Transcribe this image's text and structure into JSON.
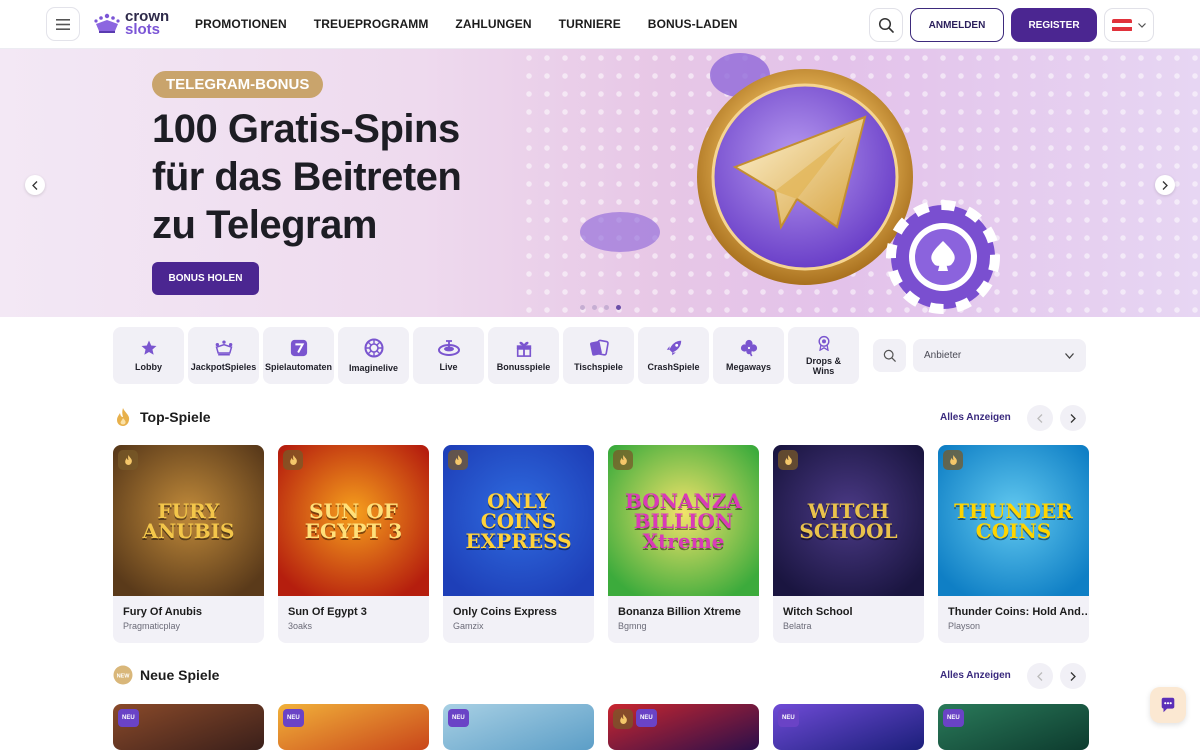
{
  "header": {
    "logo": {
      "line1": "crown",
      "line2": "slots"
    },
    "nav": [
      "PROMOTIONEN",
      "TREUEPROGRAMM",
      "ZAHLUNGEN",
      "TURNIERE",
      "BONUS-LADEN"
    ],
    "login_label": "ANMELDEN",
    "register_label": "REGISTER",
    "language_flag": "austria-flag-icon"
  },
  "hero": {
    "badge": "TELEGRAM-BONUS",
    "title_lines": [
      "100 Gratis-Spins",
      "für das Beitreten",
      "zu Telegram"
    ],
    "cta": "BONUS HOLEN",
    "slides": 4,
    "active_slide": 4
  },
  "categories": [
    {
      "label": "Lobby",
      "icon": "star-icon"
    },
    {
      "label": "JackpotSpieles",
      "icon": "crown-icon"
    },
    {
      "label": "Spielautomaten",
      "icon": "slot-seven-icon"
    },
    {
      "label": "Imaginelive",
      "icon": "chip-icon"
    },
    {
      "label": "Live",
      "icon": "roulette-icon"
    },
    {
      "label": "Bonusspiele",
      "icon": "gift-icon"
    },
    {
      "label": "Tischspiele",
      "icon": "cards-icon"
    },
    {
      "label": "CrashSpiele",
      "icon": "rocket-icon"
    },
    {
      "label": "Megaways",
      "icon": "clover-icon"
    },
    {
      "label": "Drops & Wins",
      "icon": "prize-icon"
    }
  ],
  "provider_select": {
    "placeholder": "Anbieter"
  },
  "top_games": {
    "title": "Top-Spiele",
    "view_all": "Alles Anzeigen",
    "items": [
      {
        "name": "Fury Of Anubis",
        "provider": "Pragmaticplay",
        "art": "FURY ANUBIS",
        "bg1": "#5a3a1a",
        "bg2": "#c08a3a",
        "fg": "#f3c64a"
      },
      {
        "name": "Sun Of Egypt 3",
        "provider": "3oaks",
        "art": "SUN OF EGYPT 3",
        "bg1": "#b51e0e",
        "bg2": "#f6a01d",
        "fg": "#ffe07a"
      },
      {
        "name": "Only Coins Express",
        "provider": "Gamzix",
        "art": "ONLY COINS EXPRESS",
        "bg1": "#1e3fb8",
        "bg2": "#2f6ce0",
        "fg": "#ffd23a"
      },
      {
        "name": "Bonanza Billion Xtreme",
        "provider": "Bgmng",
        "art": "BONANZA BILLION Xtreme",
        "bg1": "#3cab3c",
        "bg2": "#f2e36a",
        "fg": "#d93ab8"
      },
      {
        "name": "Witch School",
        "provider": "Belatra",
        "art": "WITCH SCHOOL",
        "bg1": "#1a1540",
        "bg2": "#4b3a86",
        "fg": "#e9c24c"
      },
      {
        "name": "Thunder Coins: Hold And…",
        "provider": "Playson",
        "art": "THUNDER COINS",
        "bg1": "#0f7fc5",
        "bg2": "#62c9f0",
        "fg": "#ffd400"
      }
    ]
  },
  "new_games": {
    "title": "Neue Spiele",
    "view_all": "Alles Anzeigen",
    "badge": "NEU",
    "items": [
      {
        "bg1": "#3a1f1a",
        "bg2": "#8a4a2a"
      },
      {
        "bg1": "#c9461a",
        "bg2": "#f1b13a"
      },
      {
        "bg1": "#5c9ec7",
        "bg2": "#a8d0e4"
      },
      {
        "bg1": "#2b0f4a",
        "bg2": "#c9262f"
      },
      {
        "bg1": "#1b1f7a",
        "bg2": "#6f4bd6"
      },
      {
        "bg1": "#0d3b2e",
        "bg2": "#2a7a5a"
      }
    ]
  }
}
